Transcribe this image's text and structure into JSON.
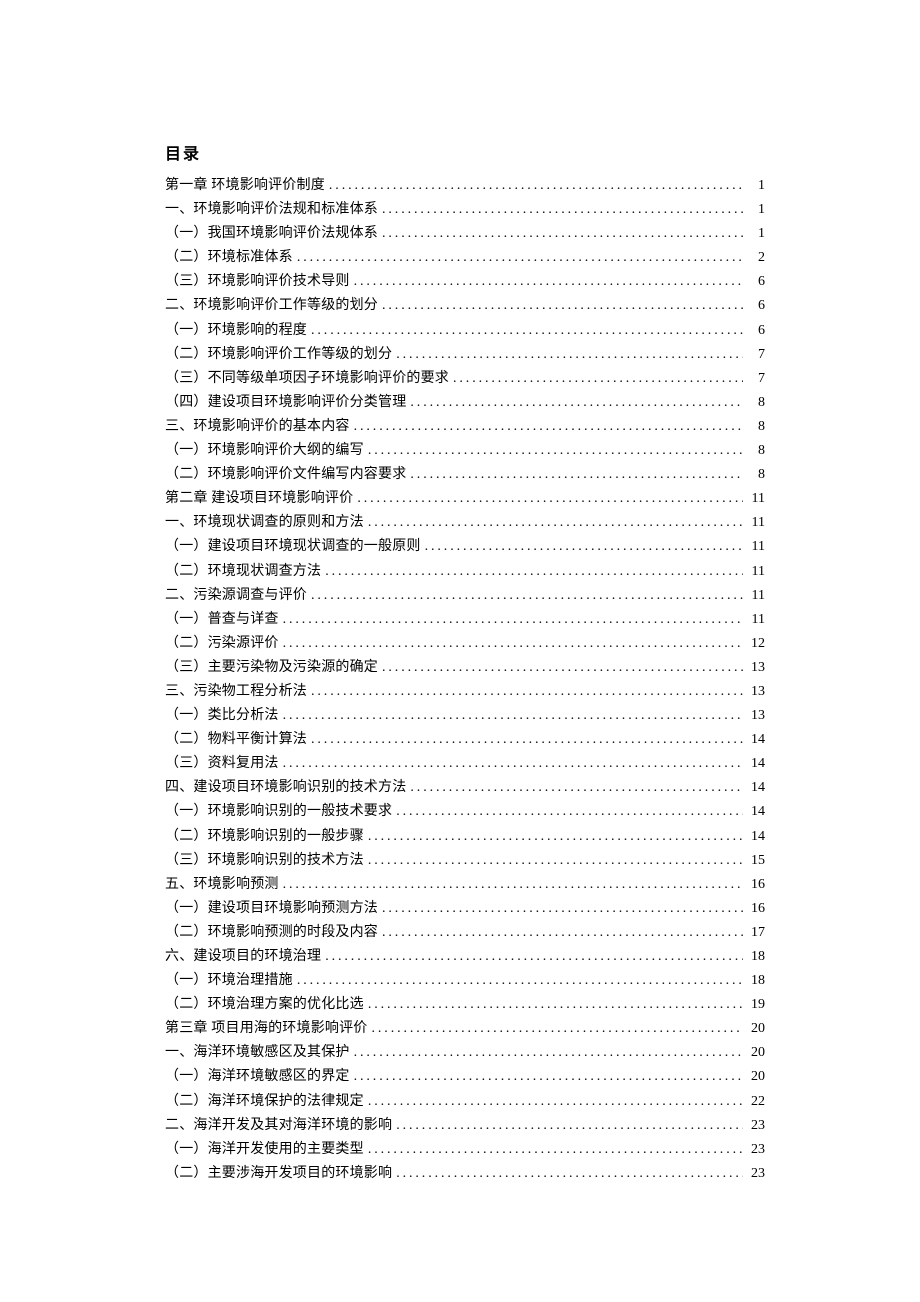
{
  "title": "目录",
  "entries": [
    {
      "text": "第一章 环境影响评价制度",
      "page": "1",
      "indent": 0
    },
    {
      "text": "一、环境影响评价法规和标准体系",
      "page": "1",
      "indent": 1
    },
    {
      "text": "（一）我国环境影响评价法规体系",
      "page": "1",
      "indent": 2
    },
    {
      "text": "（二）环境标准体系",
      "page": "2",
      "indent": 2
    },
    {
      "text": "（三）环境影响评价技术导则",
      "page": "6",
      "indent": 2
    },
    {
      "text": "二、环境影响评价工作等级的划分",
      "page": "6",
      "indent": 1
    },
    {
      "text": "（一）环境影响的程度",
      "page": "6",
      "indent": 2
    },
    {
      "text": "（二）环境影响评价工作等级的划分",
      "page": "7",
      "indent": 2
    },
    {
      "text": "（三）不同等级单项因子环境影响评价的要求",
      "page": "7",
      "indent": 2
    },
    {
      "text": "（四）建设项目环境影响评价分类管理",
      "page": "8",
      "indent": 2
    },
    {
      "text": "三、环境影响评价的基本内容",
      "page": "8",
      "indent": 1
    },
    {
      "text": "（一）环境影响评价大纲的编写",
      "page": "8",
      "indent": 2
    },
    {
      "text": "（二）环境影响评价文件编写内容要求",
      "page": "8",
      "indent": 2
    },
    {
      "text": "第二章 建设项目环境影响评价",
      "page": "11",
      "indent": 0
    },
    {
      "text": "一、环境现状调查的原则和方法",
      "page": "11",
      "indent": 1
    },
    {
      "text": "（一）建设项目环境现状调查的一般原则",
      "page": "11",
      "indent": 2
    },
    {
      "text": "（二）环境现状调查方法",
      "page": "11",
      "indent": 2
    },
    {
      "text": "二、污染源调查与评价",
      "page": "11",
      "indent": 1
    },
    {
      "text": "（一）普查与详查",
      "page": "11",
      "indent": 2
    },
    {
      "text": "（二）污染源评价",
      "page": "12",
      "indent": 2
    },
    {
      "text": "（三）主要污染物及污染源的确定",
      "page": "13",
      "indent": 2
    },
    {
      "text": "三、污染物工程分析法",
      "page": "13",
      "indent": 1
    },
    {
      "text": "（一）类比分析法",
      "page": "13",
      "indent": 2
    },
    {
      "text": "（二）物料平衡计算法",
      "page": "14",
      "indent": 2
    },
    {
      "text": "（三）资料复用法",
      "page": "14",
      "indent": 2
    },
    {
      "text": "四、建设项目环境影响识别的技术方法",
      "page": "14",
      "indent": 1
    },
    {
      "text": "（一）环境影响识别的一般技术要求",
      "page": "14",
      "indent": 2
    },
    {
      "text": "（二）环境影响识别的一般步骤",
      "page": "14",
      "indent": 2
    },
    {
      "text": "（三）环境影响识别的技术方法",
      "page": "15",
      "indent": 2
    },
    {
      "text": "五、环境影响预测",
      "page": "16",
      "indent": 1
    },
    {
      "text": "（一）建设项目环境影响预测方法",
      "page": "16",
      "indent": 2
    },
    {
      "text": "（二）环境影响预测的时段及内容",
      "page": "17",
      "indent": 2
    },
    {
      "text": "六、建设项目的环境治理",
      "page": "18",
      "indent": 1
    },
    {
      "text": "（一）环境治理措施",
      "page": "18",
      "indent": 2
    },
    {
      "text": "（二）环境治理方案的优化比选",
      "page": "19",
      "indent": 2
    },
    {
      "text": "第三章 项目用海的环境影响评价",
      "page": "20",
      "indent": 0
    },
    {
      "text": "一、海洋环境敏感区及其保护",
      "page": "20",
      "indent": 1
    },
    {
      "text": "（一）海洋环境敏感区的界定",
      "page": "20",
      "indent": 2
    },
    {
      "text": "（二）海洋环境保护的法律规定",
      "page": "22",
      "indent": 2
    },
    {
      "text": "二、海洋开发及其对海洋环境的影响",
      "page": "23",
      "indent": 1
    },
    {
      "text": "（一）海洋开发使用的主要类型",
      "page": "23",
      "indent": 2
    },
    {
      "text": "（二）主要涉海开发项目的环境影响",
      "page": "23",
      "indent": 2
    }
  ]
}
